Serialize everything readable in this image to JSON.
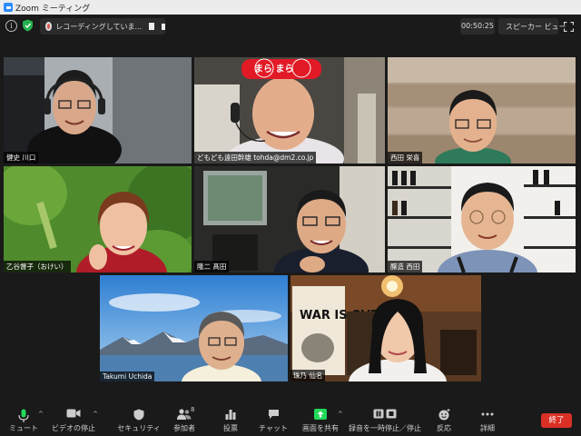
{
  "window": {
    "title": "Zoom ミーティング"
  },
  "recording": {
    "status_text": "レコーディングしていま..."
  },
  "timer": {
    "elapsed": "00:50:25"
  },
  "view": {
    "label": "スピーカー ビュー"
  },
  "participants": [
    {
      "name": "健史 川口"
    },
    {
      "name": "どもども遠田幹雄 tohda@dm2.co.jp",
      "active": true,
      "hat_text": "まら まら"
    },
    {
      "name": "西田 栄喜"
    },
    {
      "name": "乙谷督子（おけい）"
    },
    {
      "name": "隆二 髙田"
    },
    {
      "name": "醸造 西田"
    },
    {
      "name": "Takumi Uchida"
    },
    {
      "name": "珠乃 仙名",
      "poster_text": "WAR IS OVER!"
    }
  ],
  "toolbar": {
    "mute_label": "ミュート",
    "video_label": "ビデオの停止",
    "security_label": "セキュリティ",
    "participants_label": "参加者",
    "participants_count": "8",
    "poll_label": "投票",
    "chat_label": "チャット",
    "share_label": "画面を共有",
    "recording_label": "録音を一時停止／停止",
    "reaction_label": "反応",
    "more_label": "詳細",
    "end_label": "終了"
  },
  "colors": {
    "active_speaker": "#c9d54a",
    "share": "#23d959",
    "end": "#d93025",
    "zoom_blue": "#2d8cff"
  }
}
